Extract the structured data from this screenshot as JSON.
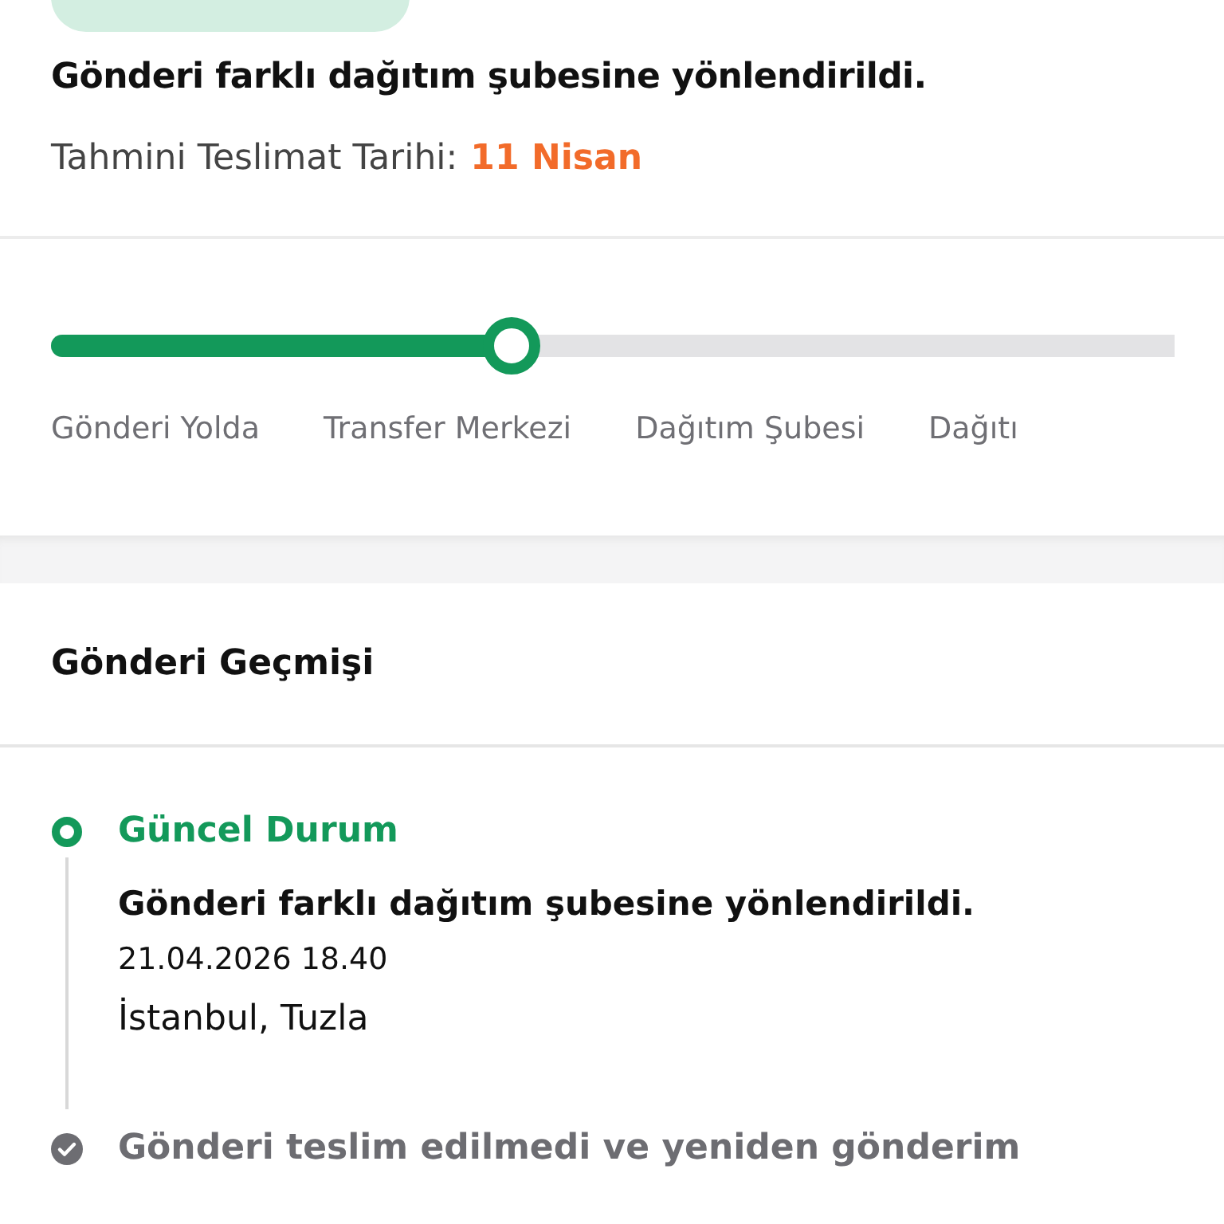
{
  "summary": {
    "badge": {
      "kind": "badge"
    },
    "message": "Gönderi farklı dağıtım şubesine yönlendirildi.",
    "eta_label": "Tahmini Teslimat Tarihi:",
    "eta_value": "11 Nisan"
  },
  "progress": {
    "level": 0.41,
    "stages": [
      "Gönderi Yolda",
      "Transfer Merkezi",
      "Dağıtım Şubesi",
      "Dağıtı"
    ]
  },
  "history": {
    "title": "Gönderi Geçmişi",
    "events": [
      {
        "kind": "current",
        "title": "Güncel Durum",
        "message": "Gönderi farklı dağıtım şubesine yönlendirildi.",
        "time": "21.04.2026 18.40",
        "place": "İstanbul, Tuzla"
      },
      {
        "kind": "past",
        "title": "Gönderi teslim edilmedi ve yeniden gönderim"
      }
    ]
  }
}
